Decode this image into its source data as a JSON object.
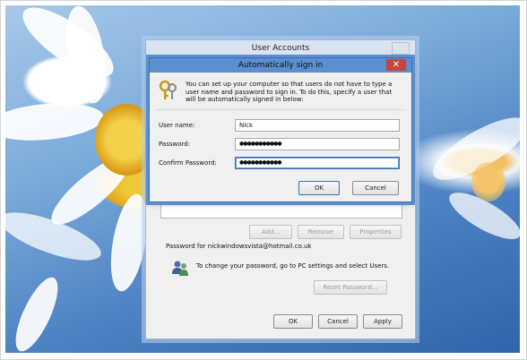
{
  "outer_window": {
    "title": "User Accounts",
    "buttons": {
      "add": "Add...",
      "remove": "Remove",
      "properties": "Properties",
      "reset_password": "Reset Password...",
      "ok": "OK",
      "cancel": "Cancel",
      "apply": "Apply"
    },
    "password_section_label": "Password for nickwindowsvista@hotmail.co.uk",
    "password_hint": "To change your password, go to PC settings and select Users."
  },
  "dialog": {
    "title": "Automatically sign in",
    "close_glyph": "✕",
    "description": "You can set up your computer so that users do not have to type a user name and password to sign in. To do this, specify a user that will be automatically signed in below:",
    "fields": {
      "username_label": "User name:",
      "username_value": "Nick",
      "password_label": "Password:",
      "password_value": "●●●●●●●●●●●",
      "confirm_label": "Confirm Password:",
      "confirm_value": "●●●●●●●●●●●"
    },
    "ok_label": "OK",
    "cancel_label": "Cancel"
  },
  "colors": {
    "dialog_border": "#3d6fb8",
    "close_red": "#c7463a",
    "focus_blue": "#3a6fb0"
  },
  "icons": {
    "keys": "keys-icon",
    "users": "users-icon",
    "close": "close-icon"
  }
}
